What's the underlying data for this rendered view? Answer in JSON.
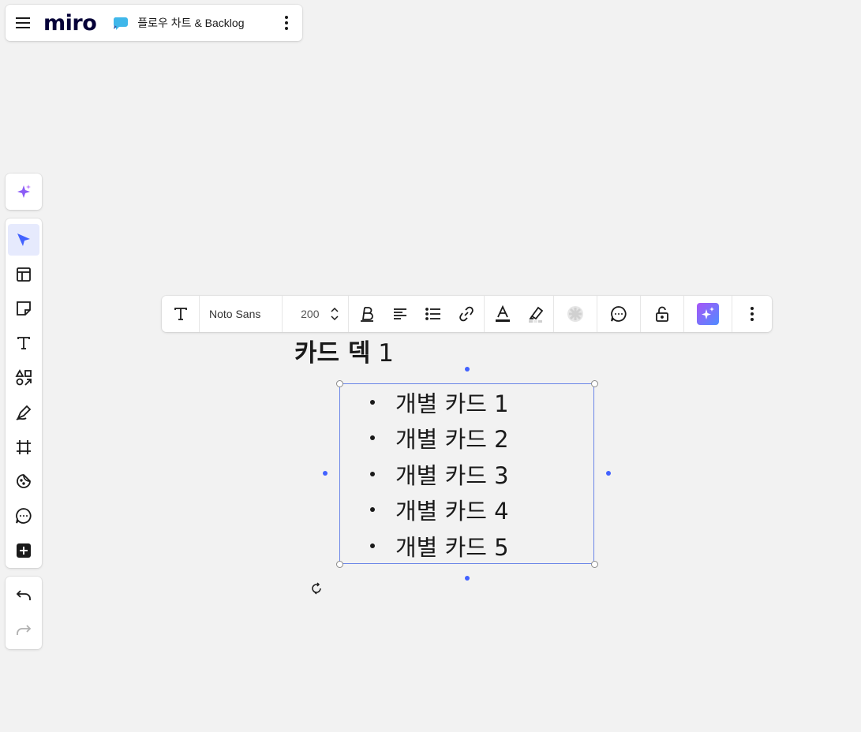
{
  "app": {
    "logo": "miro",
    "board_name": "플로우 차트 & Backlog"
  },
  "icons": {
    "menu": "hamburger-menu-icon",
    "board": "board-chat-bubble-icon",
    "more": "vertical-dots-icon"
  },
  "left_toolbar": {
    "ai": "sparkle-icon",
    "tools": [
      "select-cursor-icon",
      "templates-icon",
      "sticky-note-icon",
      "text-icon",
      "shapes-icon",
      "pen-icon",
      "frame-icon",
      "stickers-icon",
      "comment-icon",
      "add-more-icon"
    ],
    "active_tool": "select-cursor-icon",
    "history": [
      "undo-icon",
      "redo-icon"
    ]
  },
  "text_toolbar": {
    "font_name": "Noto Sans",
    "font_size": "200"
  },
  "canvas": {
    "deck_title_bold": "카드 덱",
    "deck_title_num": " 1",
    "cards": [
      "개별 카드 1",
      "개별 카드 2",
      "개별 카드 3",
      "개별 카드 4",
      "개별 카드 5"
    ]
  },
  "colors": {
    "accent": "#4262ff",
    "selection": "#6b86e8",
    "canvas_bg": "#f2f2f2",
    "ai_gradient_start": "#9b5cf6",
    "ai_gradient_end": "#4f8cff"
  }
}
